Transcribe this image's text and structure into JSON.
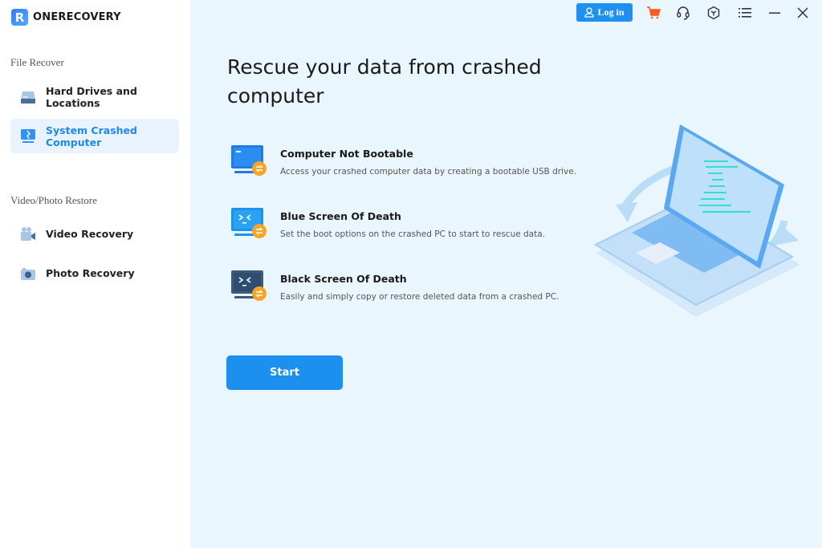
{
  "app": {
    "name": "ONERECOVERY",
    "logo_letter": "R"
  },
  "sidebar": {
    "sections": [
      {
        "label": "File Recover",
        "items": [
          {
            "label": "Hard Drives and Locations",
            "icon": "hard-drive-icon",
            "active": false
          },
          {
            "label": "System Crashed Computer",
            "icon": "crashed-computer-icon",
            "active": true
          }
        ]
      },
      {
        "label": "Video/Photo Restore",
        "items": [
          {
            "label": "Video Recovery",
            "icon": "video-camera-icon",
            "active": false
          },
          {
            "label": "Photo Recovery",
            "icon": "camera-icon",
            "active": false
          }
        ]
      }
    ]
  },
  "topbar": {
    "login_label": "Log in",
    "icons": [
      "cart-icon",
      "headset-icon",
      "cube-icon",
      "menu-list-icon",
      "minimize-icon",
      "close-icon"
    ]
  },
  "main": {
    "title": "Rescue your data from crashed computer",
    "options": [
      {
        "title": "Computer Not Bootable",
        "description": "Access your crashed computer data by creating a bootable USB drive.",
        "icon": "monitor-not-bootable-icon"
      },
      {
        "title": "Blue Screen Of Death",
        "description": "Set the boot options on the crashed PC to start to rescue data.",
        "icon": "blue-screen-icon"
      },
      {
        "title": "Black Screen Of Death",
        "description": "Easily and simply copy or restore deleted data from a crashed PC.",
        "icon": "black-screen-icon"
      }
    ],
    "start_label": "Start"
  },
  "colors": {
    "accent": "#1c90ee",
    "main_bg": "#eaf6fd",
    "active_item_bg": "#e8f3fd",
    "cart": "#ff5a1f",
    "badge_orange": "#f7a427"
  }
}
